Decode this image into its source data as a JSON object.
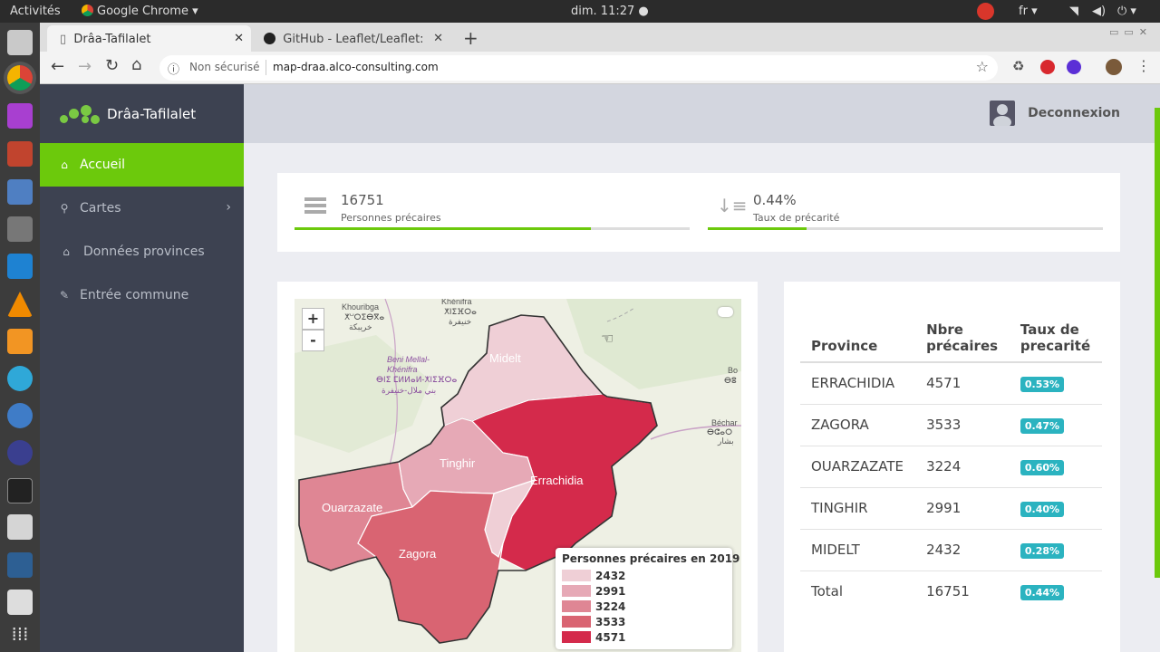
{
  "os": {
    "activities": "Activités",
    "app_menu": "Google Chrome",
    "clock": "dim. 11:27",
    "lang": "fr"
  },
  "browser": {
    "tabs": [
      {
        "title": "Drâa-Tafilalet"
      },
      {
        "title": "GitHub - Leaflet/Leaflet: J"
      }
    ],
    "security": "Non sécurisé",
    "url": "map-draa.alco-consulting.com"
  },
  "app": {
    "brand": "Drâa-Tafilalet",
    "logout": "Deconnexion",
    "nav": [
      {
        "label": "Accueil",
        "icon": "home-icon",
        "active": true
      },
      {
        "label": "Cartes",
        "icon": "map-marker-icon",
        "active": false
      },
      {
        "label": "Données provinces",
        "icon": "bank-icon",
        "active": false
      },
      {
        "label": "Entrée commune",
        "icon": "edit-icon",
        "active": false
      }
    ]
  },
  "stats": [
    {
      "value": "16751",
      "label": "Personnes précaires",
      "icon": "list-icon",
      "progress": 0.75
    },
    {
      "value": "0.44%",
      "label": "Taux de précarité",
      "icon": "sort-desc-icon",
      "progress": 0.25
    }
  ],
  "map": {
    "zoom_in": "+",
    "zoom_out": "-",
    "provinces": [
      "Midelt",
      "Tinghir",
      "Errachidia",
      "Ouarzazate",
      "Zagora"
    ],
    "place_labels": [
      "Khouribga",
      "ⵅⵯⵔⵉⴱⴳⴰ",
      "خريبكة",
      "Khénifra",
      "ⵅⵏⵉⴼⵔⴰ",
      "خنيفرة",
      "Beni Mellal-",
      "Khénifra",
      "ⴱⵏⵉ ⵎⵍⵍⴰⵍ-ⵅⵏⵉⴼⵔⴰ",
      "بني ملال-خنيفرة",
      "Béchar",
      "ⴱⵛⴰⵔ",
      "بشار",
      "Bo",
      "ⴱⵓ"
    ],
    "legend_title": "Personnes précaires en 2019",
    "legend": [
      {
        "label": "2432",
        "color": "#efcfd6"
      },
      {
        "label": "2991",
        "color": "#e6a9b6"
      },
      {
        "label": "3224",
        "color": "#df8694"
      },
      {
        "label": "3533",
        "color": "#d96472"
      },
      {
        "label": "4571",
        "color": "#d42a4b"
      }
    ]
  },
  "table": {
    "headers": {
      "province": "Province",
      "count_1": "Nbre",
      "count_2": "précaires",
      "rate_1": "Taux de",
      "rate_2": "precarité"
    },
    "rows": [
      {
        "province": "ERRACHIDIA",
        "count": "4571",
        "rate": "0.53%"
      },
      {
        "province": "ZAGORA",
        "count": "3533",
        "rate": "0.47%"
      },
      {
        "province": "OUARZAZATE",
        "count": "3224",
        "rate": "0.60%"
      },
      {
        "province": "TINGHIR",
        "count": "2991",
        "rate": "0.40%"
      },
      {
        "province": "MIDELT",
        "count": "2432",
        "rate": "0.28%"
      },
      {
        "province": "Total",
        "count": "16751",
        "rate": "0.44%"
      }
    ]
  }
}
